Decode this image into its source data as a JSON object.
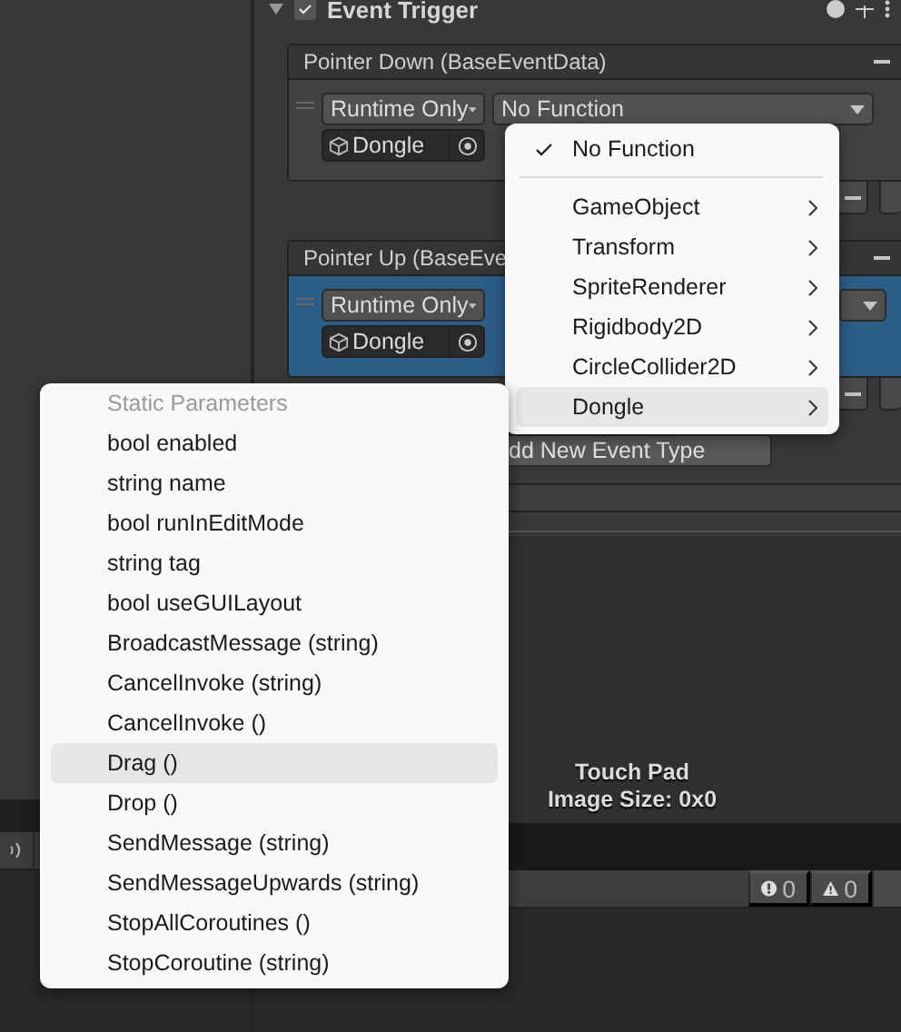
{
  "inspector": {
    "component_title": "Event Trigger",
    "enabled": true,
    "events": [
      {
        "title": "Pointer Down (BaseEventData)",
        "selected": false,
        "mode": "Runtime Only",
        "target": "Dongle",
        "function": "No Function"
      },
      {
        "title": "Pointer Up (BaseEve",
        "selected": true,
        "mode": "Runtime Only",
        "target": "Dongle"
      }
    ],
    "add_button": "dd New Event Type"
  },
  "preview": {
    "title": "Touch Pad",
    "info": "Image Size: 0x0"
  },
  "console": {
    "counts": [
      {
        "kind": "info",
        "count": "0"
      },
      {
        "kind": "warning",
        "count": "0"
      }
    ]
  },
  "function_menu": {
    "items": [
      {
        "label": "No Function",
        "kind": "option",
        "checked": true,
        "selected": false
      },
      {
        "label": "GameObject",
        "kind": "component",
        "checked": false,
        "selected": false
      },
      {
        "label": "Transform",
        "kind": "component",
        "checked": false,
        "selected": false
      },
      {
        "label": "SpriteRenderer",
        "kind": "component",
        "checked": false,
        "selected": false
      },
      {
        "label": "Rigidbody2D",
        "kind": "component",
        "checked": false,
        "selected": false
      },
      {
        "label": "CircleCollider2D",
        "kind": "component",
        "checked": false,
        "selected": false
      },
      {
        "label": "Dongle",
        "kind": "component",
        "checked": false,
        "selected": true
      }
    ]
  },
  "parameter_menu": {
    "header": "Static Parameters",
    "items": [
      {
        "label": "bool enabled",
        "selected": false
      },
      {
        "label": "string name",
        "selected": false
      },
      {
        "label": "bool runInEditMode",
        "selected": false
      },
      {
        "label": "string tag",
        "selected": false
      },
      {
        "label": "bool useGUILayout",
        "selected": false
      },
      {
        "label": "BroadcastMessage (string)",
        "selected": false
      },
      {
        "label": "CancelInvoke (string)",
        "selected": false
      },
      {
        "label": "CancelInvoke ()",
        "selected": false
      },
      {
        "label": "Drag ()",
        "selected": true
      },
      {
        "label": "Drop ()",
        "selected": false
      },
      {
        "label": "SendMessage (string)",
        "selected": false
      },
      {
        "label": "SendMessageUpwards (string)",
        "selected": false
      },
      {
        "label": "StopAllCoroutines ()",
        "selected": false
      },
      {
        "label": "StopCoroutine (string)",
        "selected": false
      }
    ]
  }
}
